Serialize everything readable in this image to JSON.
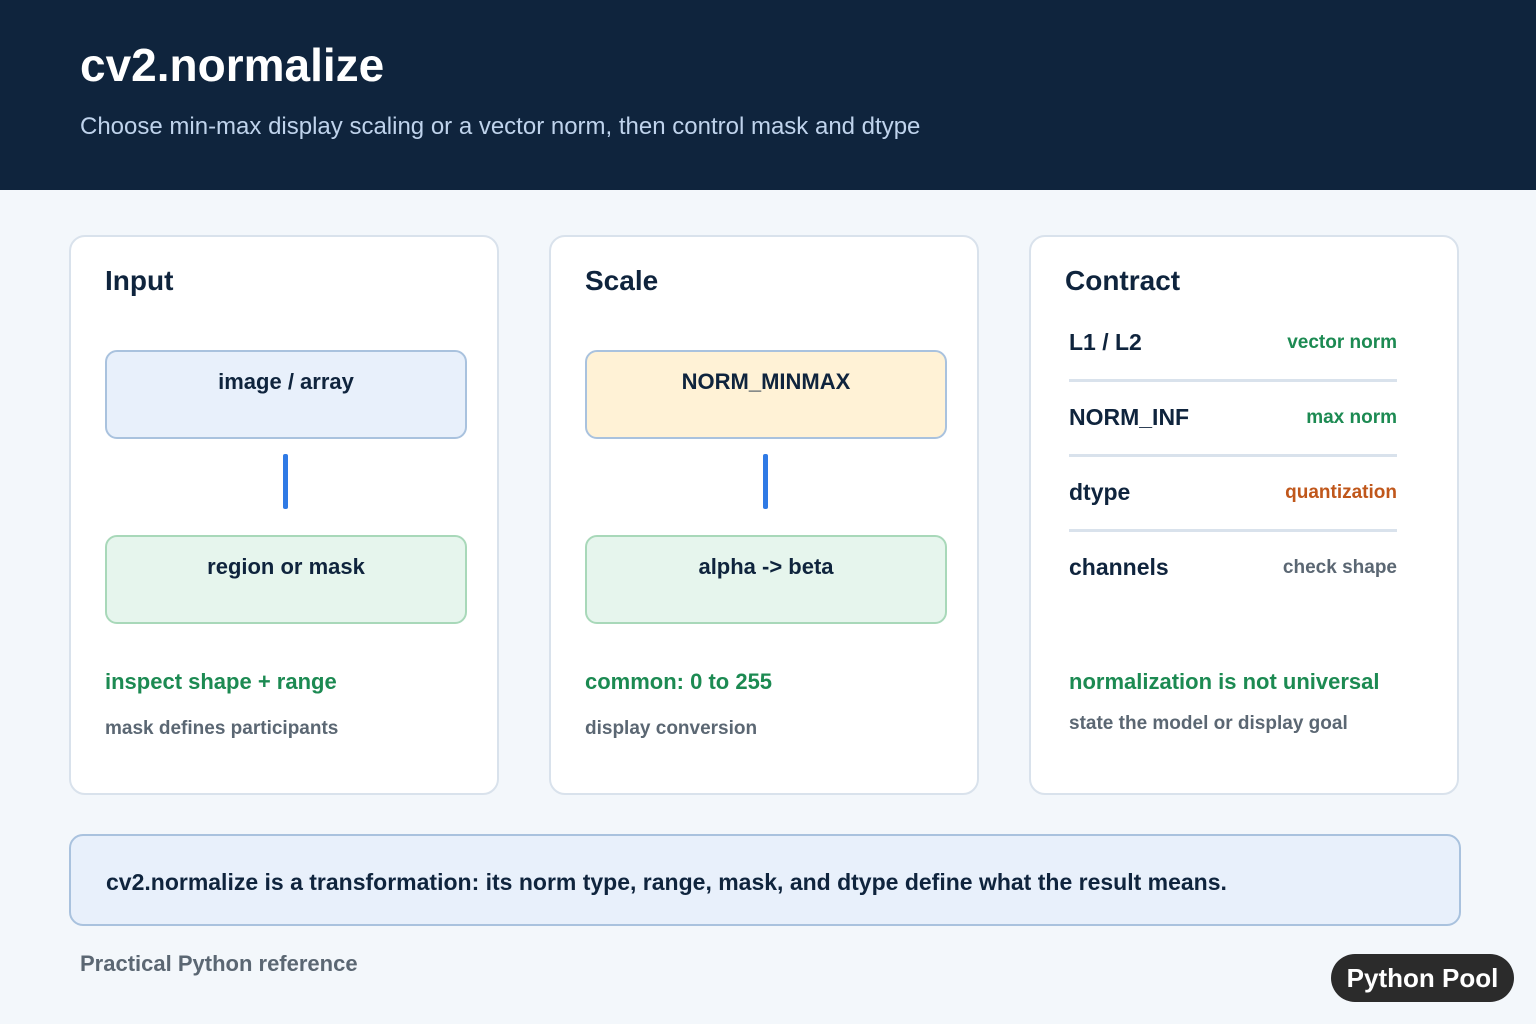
{
  "header": {
    "title": "cv2.normalize",
    "subtitle": "Choose min-max display scaling or a vector norm, then control mask and dtype"
  },
  "cards": {
    "input": {
      "title": "Input",
      "top_node": "image / array",
      "bottom_node": "region or mask",
      "note_primary": "inspect shape + range",
      "note_secondary": "mask defines participants"
    },
    "scale": {
      "title": "Scale",
      "top_node": "NORM_MINMAX",
      "bottom_node": "alpha -> beta",
      "note_primary": "common: 0 to 255",
      "note_secondary": "display conversion"
    },
    "contract": {
      "title": "Contract",
      "rows": [
        {
          "key": "L1 / L2",
          "value": "vector norm",
          "color": "#1c8a52"
        },
        {
          "key": "NORM_INF",
          "value": "max norm",
          "color": "#1c8a52"
        },
        {
          "key": "dtype",
          "value": "quantization",
          "color": "#c0571b"
        },
        {
          "key": "channels",
          "value": "check shape",
          "color": "#5b6773"
        }
      ],
      "note_primary": "normalization is not universal",
      "note_secondary": "state the model or display goal"
    }
  },
  "callout": "cv2.normalize is a transformation: its norm type, range, mask, and dtype define what the result means.",
  "footer": "Practical Python reference",
  "brand": "Python Pool",
  "colors": {
    "header_bg": "#0f243d",
    "accent_blue": "#2f7ae5",
    "green": "#1c8a52",
    "orange": "#c0571b"
  }
}
